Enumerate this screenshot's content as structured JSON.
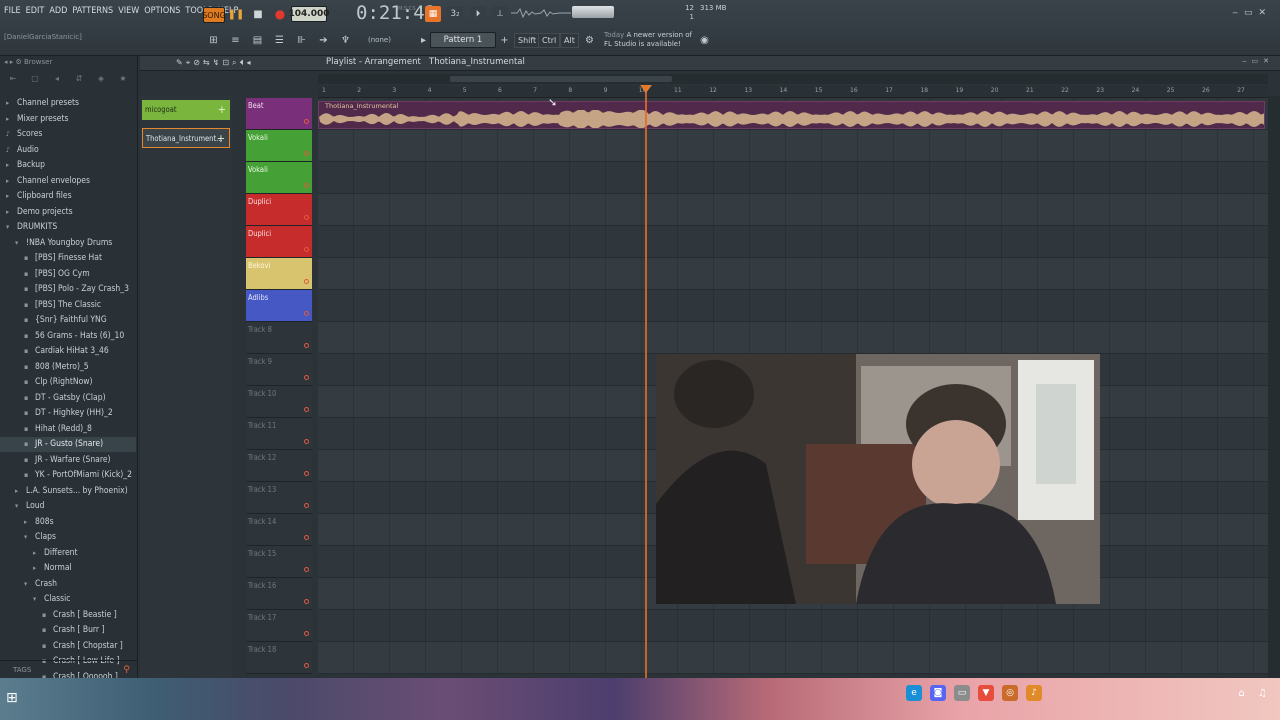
{
  "menu": [
    "FILE",
    "EDIT",
    "ADD",
    "PATTERNS",
    "VIEW",
    "OPTIONS",
    "TOOLS",
    "HELP"
  ],
  "transport": {
    "song_label": "SONG",
    "bpm": "104.000",
    "time": "0:21:42",
    "time_unit": "M:S:CS"
  },
  "stats": {
    "cpu": "12",
    "cpu_sub": "1",
    "memory": "313 MB"
  },
  "user_label": "[DanielGarciaStanicic]",
  "toolbar": {
    "none_label": "(none)",
    "pattern": "Pattern 1",
    "shift": "Shift",
    "ctrl": "Ctrl",
    "alt": "Alt"
  },
  "news": {
    "when": "Today",
    "line1": "A newer version of",
    "line2": "FL Studio is available!"
  },
  "browser": {
    "title": "Browser",
    "items": [
      {
        "label": "Channel presets",
        "indent": 0,
        "icon": "▸"
      },
      {
        "label": "Mixer presets",
        "indent": 0,
        "icon": "▸"
      },
      {
        "label": "Scores",
        "indent": 0,
        "icon": "♪"
      },
      {
        "label": "Audio",
        "indent": 0,
        "icon": "♪"
      },
      {
        "label": "Backup",
        "indent": 0,
        "icon": "▸"
      },
      {
        "label": "Channel envelopes",
        "indent": 0,
        "icon": "▸"
      },
      {
        "label": "Clipboard files",
        "indent": 0,
        "icon": "▸"
      },
      {
        "label": "Demo projects",
        "indent": 0,
        "icon": "▸"
      },
      {
        "label": "DRUMKITS",
        "indent": 0,
        "icon": "▾"
      },
      {
        "label": "!NBA Youngboy Drums",
        "indent": 1,
        "icon": "▾"
      },
      {
        "label": "[PBS] Finesse Hat",
        "indent": 2,
        "icon": "▪"
      },
      {
        "label": "[PBS] OG Cym",
        "indent": 2,
        "icon": "▪"
      },
      {
        "label": "[PBS] Polo - Zay Crash_3",
        "indent": 2,
        "icon": "▪"
      },
      {
        "label": "[PBS] The Classic",
        "indent": 2,
        "icon": "▪"
      },
      {
        "label": "{Snr} Faithful YNG",
        "indent": 2,
        "icon": "▪"
      },
      {
        "label": "56 Grams - Hats (6)_10",
        "indent": 2,
        "icon": "▪"
      },
      {
        "label": "Cardiak HiHat 3_46",
        "indent": 2,
        "icon": "▪"
      },
      {
        "label": "808 (Metro)_5",
        "indent": 2,
        "icon": "▪"
      },
      {
        "label": "Clp (RightNow)",
        "indent": 2,
        "icon": "▪"
      },
      {
        "label": "DT - Gatsby (Clap)",
        "indent": 2,
        "icon": "▪"
      },
      {
        "label": "DT - Highkey (HH)_2",
        "indent": 2,
        "icon": "▪"
      },
      {
        "label": "Hihat (Redd)_8",
        "indent": 2,
        "icon": "▪"
      },
      {
        "label": "JR - Gusto (Snare)",
        "indent": 2,
        "icon": "▪"
      },
      {
        "label": "JR - Warfare (Snare)",
        "indent": 2,
        "icon": "▪"
      },
      {
        "label": "YK - PortOfMiami (Kick)_2",
        "indent": 2,
        "icon": "▪"
      },
      {
        "label": "L.A. Sunsets... by Phoenix)",
        "indent": 1,
        "icon": "▸"
      },
      {
        "label": "Loud",
        "indent": 1,
        "icon": "▾"
      },
      {
        "label": "808s",
        "indent": 2,
        "icon": "▸"
      },
      {
        "label": "Claps",
        "indent": 2,
        "icon": "▾"
      },
      {
        "label": "Different",
        "indent": 3,
        "icon": "▸"
      },
      {
        "label": "Normal",
        "indent": 3,
        "icon": "▸"
      },
      {
        "label": "Crash",
        "indent": 2,
        "icon": "▾"
      },
      {
        "label": "Classic",
        "indent": 3,
        "icon": "▾"
      },
      {
        "label": "Crash [ Beastie ]",
        "indent": 4,
        "icon": "▪"
      },
      {
        "label": "Crash [ Burr ]",
        "indent": 4,
        "icon": "▪"
      },
      {
        "label": "Crash [ Chopstar ]",
        "indent": 4,
        "icon": "▪"
      },
      {
        "label": "Crash [ Low Life ]",
        "indent": 4,
        "icon": "▪"
      },
      {
        "label": "Crash [ Oooooh ]",
        "indent": 4,
        "icon": "▪"
      }
    ],
    "tags_label": "TAGS"
  },
  "picker": [
    {
      "label": "micogoat"
    },
    {
      "label": "Thotiana_Instrument..."
    }
  ],
  "playlist": {
    "title": "Playlist - Arrangement",
    "pattern": "Thotiana_Instrumental",
    "ruler": [
      "1",
      "2",
      "3",
      "4",
      "5",
      "6",
      "7",
      "8",
      "9",
      "10",
      "11",
      "12",
      "13",
      "14",
      "15",
      "16",
      "17",
      "18",
      "19",
      "20",
      "21",
      "22",
      "23",
      "24",
      "25",
      "26",
      "27"
    ],
    "clip_label": "Thotiana_Instrumental",
    "playhead_bar": 10.3,
    "tracks": [
      {
        "name": "Beat",
        "color": "#7a2f7a",
        "text": "#f0d8ee"
      },
      {
        "name": "Vokali",
        "color": "#45a035",
        "text": "#e9f7e2"
      },
      {
        "name": "Vokali",
        "color": "#45a035",
        "text": "#e9f7e2"
      },
      {
        "name": "Duplici",
        "color": "#c62c2c",
        "text": "#f9e0e0"
      },
      {
        "name": "Duplici",
        "color": "#c62c2c",
        "text": "#f9e0e0"
      },
      {
        "name": "Bekovi",
        "color": "#d8c46e",
        "text": "#fff6d8"
      },
      {
        "name": "Adlibs",
        "color": "#4658c4",
        "text": "#e3e7fb"
      },
      {
        "name": "Track 8",
        "color": "#2d353a",
        "text": "#6e7a80"
      },
      {
        "name": "Track 9",
        "color": "#2d353a",
        "text": "#6e7a80"
      },
      {
        "name": "Track 10",
        "color": "#2d353a",
        "text": "#6e7a80"
      },
      {
        "name": "Track 11",
        "color": "#2d353a",
        "text": "#6e7a80"
      },
      {
        "name": "Track 12",
        "color": "#2d353a",
        "text": "#6e7a80"
      },
      {
        "name": "Track 13",
        "color": "#2d353a",
        "text": "#6e7a80"
      },
      {
        "name": "Track 14",
        "color": "#2d353a",
        "text": "#6e7a80"
      },
      {
        "name": "Track 15",
        "color": "#2d353a",
        "text": "#6e7a80"
      },
      {
        "name": "Track 16",
        "color": "#2d353a",
        "text": "#6e7a80"
      },
      {
        "name": "Track 17",
        "color": "#2d353a",
        "text": "#6e7a80"
      },
      {
        "name": "Track 18",
        "color": "#2d353a",
        "text": "#6e7a80"
      }
    ]
  },
  "colors": {
    "accent": "#e37a2c",
    "clip": "#512a4b",
    "wave": "#d9b98f"
  }
}
